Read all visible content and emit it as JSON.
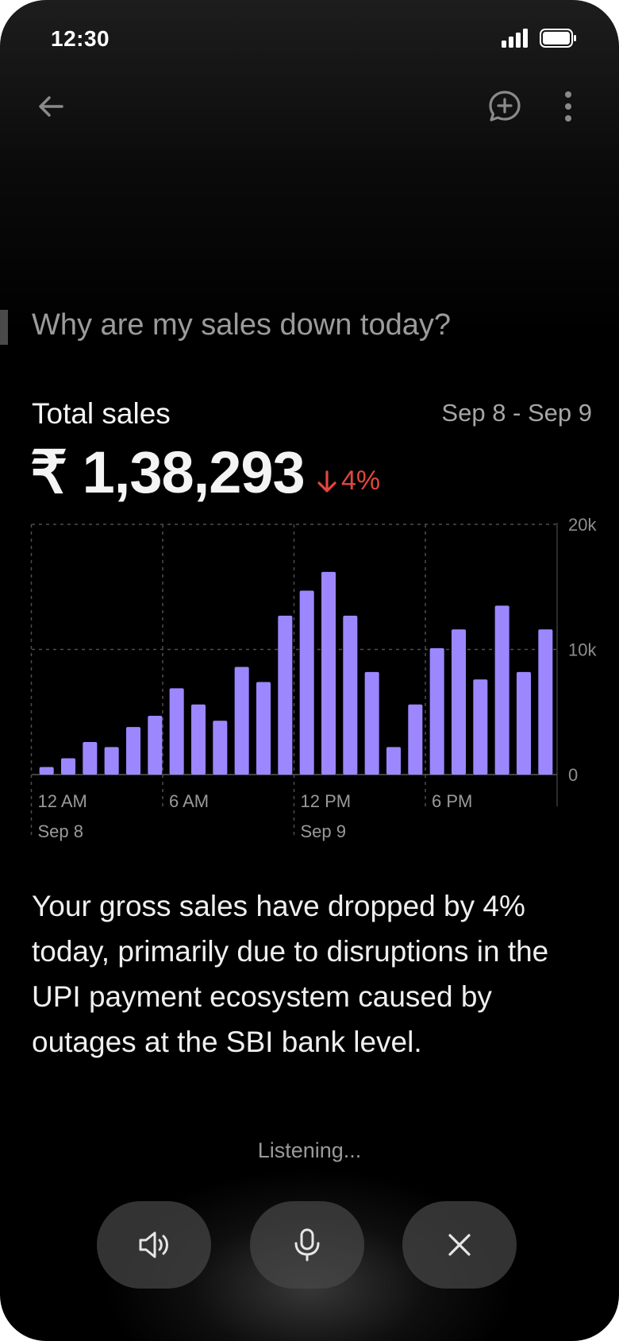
{
  "status_bar": {
    "time": "12:30"
  },
  "topbar": {
    "back_icon": "arrow-left-icon",
    "new_chat_icon": "chat-plus-icon",
    "more_icon": "more-vertical-icon"
  },
  "question": "Why are my sales down today?",
  "summary": {
    "label": "Total sales",
    "date_range": "Sep 8 - Sep 9",
    "value": "₹ 1,38,293",
    "change": "4%",
    "change_direction": "down",
    "change_color": "#e2473c"
  },
  "chart_data": {
    "type": "bar",
    "bar_color": "#9c87ff",
    "ylim": [
      0,
      20000
    ],
    "y_ticks": [
      "20k",
      "10k",
      "0"
    ],
    "x_tick_labels": [
      "12 AM",
      "6 AM",
      "12 PM",
      "6 PM"
    ],
    "x_date_labels": [
      "Sep 8",
      "Sep 9"
    ],
    "grid": true,
    "values": [
      600,
      1300,
      2600,
      2200,
      3800,
      4700,
      6900,
      5600,
      4300,
      8600,
      7400,
      12700,
      14700,
      16200,
      12700,
      8200,
      2200,
      5600,
      10100,
      11600,
      7600,
      13500,
      8200,
      11600
    ]
  },
  "insight": "Your gross sales have dropped by 4% today, primarily due to disruptions in the UPI payment ecosystem caused by outages at the SBI bank level.",
  "listening_text": "Listening...",
  "controls": {
    "speaker_icon": "speaker-icon",
    "mic_icon": "microphone-icon",
    "close_icon": "close-icon"
  }
}
